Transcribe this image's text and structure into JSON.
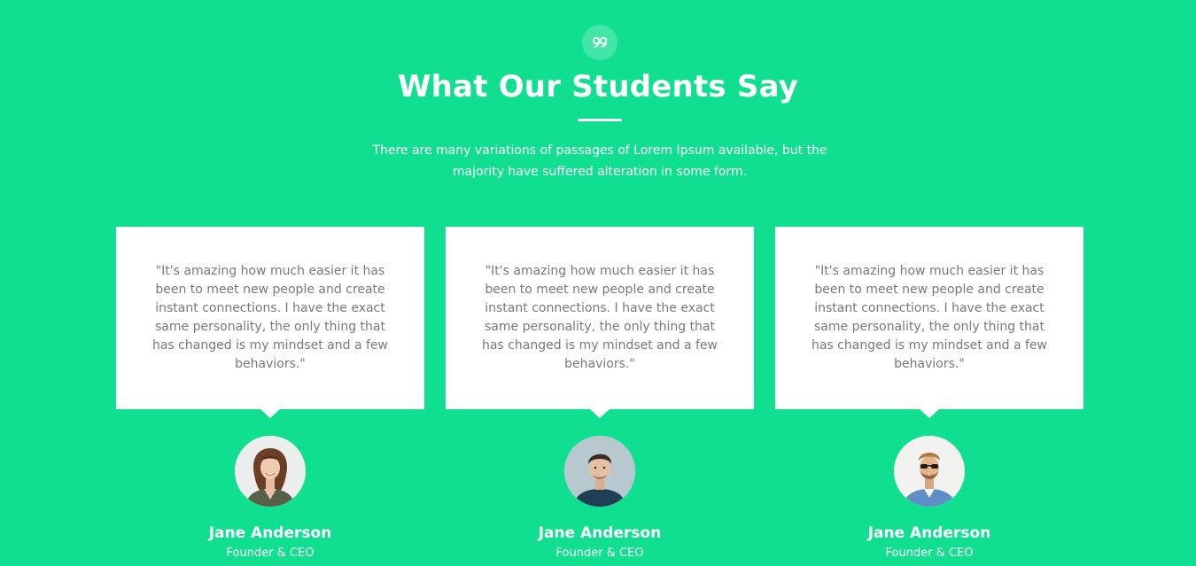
{
  "section": {
    "title": "What Our Students Say",
    "subtitle": "There are many variations of passages of Lorem Ipsum available, but the majority have suffered alteration in some form.",
    "badge_icon": "quote-icon",
    "accent_color": "#10df8f"
  },
  "testimonials": [
    {
      "quote": "\"It's amazing how much easier it has been to meet new people and create instant connections. I have the exact same personality, the only thing that has changed is my mindset and a few behaviors.\"",
      "name": "Jane Anderson",
      "role": "Founder & CEO",
      "avatar_icon": "woman-avatar-icon"
    },
    {
      "quote": "\"It's amazing how much easier it has been to meet new people and create instant connections. I have the exact same personality, the only thing that has changed is my mindset and a few behaviors.\"",
      "name": "Jane Anderson",
      "role": "Founder & CEO",
      "avatar_icon": "man-avatar-icon"
    },
    {
      "quote": "\"It's amazing how much easier it has been to meet new people and create instant connections. I have the exact same personality, the only thing that has changed is my mindset and a few behaviors.\"",
      "name": "Jane Anderson",
      "role": "Founder & CEO",
      "avatar_icon": "man-sunglasses-avatar-icon"
    }
  ]
}
